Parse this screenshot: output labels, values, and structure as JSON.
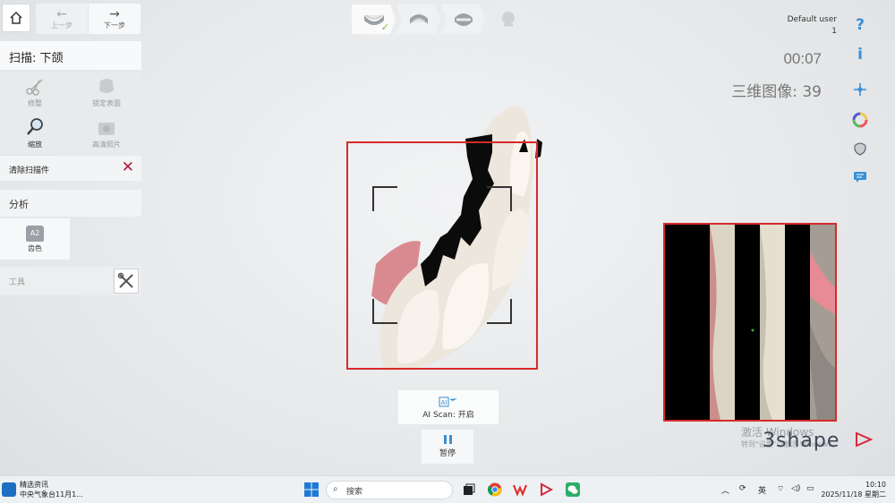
{
  "nav": {
    "prev_label": "上一步",
    "next_label": "下一步"
  },
  "panel": {
    "title": "扫描: 下颌",
    "tools": [
      {
        "label": "修整",
        "icon": "scissors-icon",
        "enabled": false
      },
      {
        "label": "锁定表面",
        "icon": "lock-surface-icon",
        "enabled": false
      },
      {
        "label": "缩放",
        "icon": "magnifier-icon",
        "enabled": true
      },
      {
        "label": "高清照片",
        "icon": "hd-photo-icon",
        "enabled": false
      }
    ],
    "clear_label": "清除扫描件",
    "analysis_label": "分析",
    "shade_badge": "A2",
    "shade_label": "齿色",
    "tools_label": "工具"
  },
  "user": {
    "name": "Default user",
    "id": "1"
  },
  "scan": {
    "timer": "00:07",
    "images_label": "三维图像: 39"
  },
  "ai_scan": {
    "badge": "AI",
    "label": "AI Scan: 开启"
  },
  "pause_label": "暂停",
  "watermark": {
    "line1": "激活 Windows",
    "line2": "转到\"设置\"以激活 Windows。"
  },
  "logo": "3shape",
  "colors": {
    "accent": "#3a8fd3",
    "alert": "#d62a2a",
    "clear_x": "#b01c3c"
  },
  "taskbar": {
    "news_title": "精选资讯",
    "news_sub": "中央气象台11月1...",
    "search_placeholder": "搜索",
    "lang": "英",
    "time": "10:10",
    "date": "2025/11/18 星期二"
  }
}
